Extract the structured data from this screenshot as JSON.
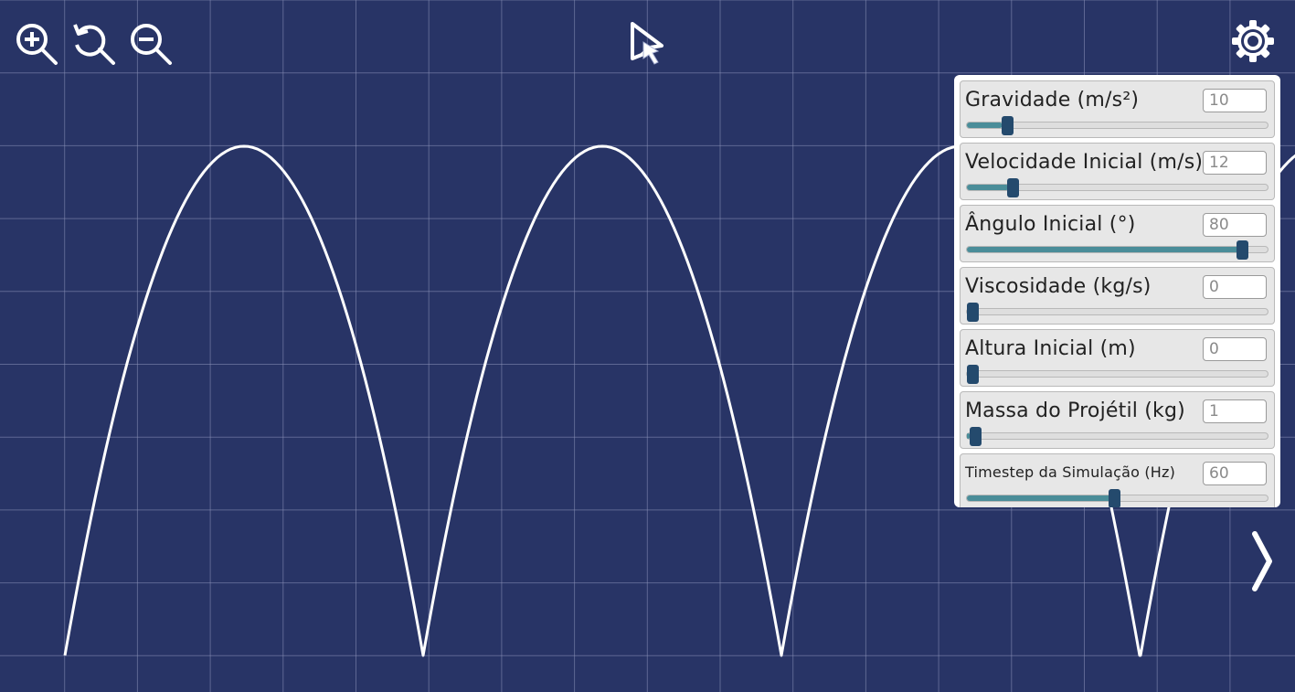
{
  "toolbar": {
    "zoom_in_icon": "zoom-in-icon",
    "reset_zoom_icon": "reset-zoom-icon",
    "zoom_out_icon": "zoom-out-icon",
    "pointer_icon": "pointer-icon",
    "settings_icon": "gear-icon",
    "next_icon": "chevron-right-icon"
  },
  "colors": {
    "background": "#283466",
    "grid": "#8a92b8",
    "trajectory": "#ffffff",
    "slider_fill": "#4a8d99",
    "slider_thumb": "#244a6d"
  },
  "controls": [
    {
      "label": "Gravidade (m/s²)",
      "value": "10",
      "level": 0.12
    },
    {
      "label": "Velocidade Inicial (m/s)",
      "value": "12",
      "level": 0.14
    },
    {
      "label": "Ângulo Inicial (°)",
      "value": "80",
      "level": 0.93
    },
    {
      "label": "Viscosidade (kg/s)",
      "value": "0",
      "level": 0.0
    },
    {
      "label": "Altura Inicial (m)",
      "value": "0",
      "level": 0.0
    },
    {
      "label": "Massa do Projétil (kg)",
      "value": "1",
      "level": 0.01
    },
    {
      "label": "Timestep da Simulação (Hz)",
      "value": "60",
      "level": 0.49
    }
  ]
}
